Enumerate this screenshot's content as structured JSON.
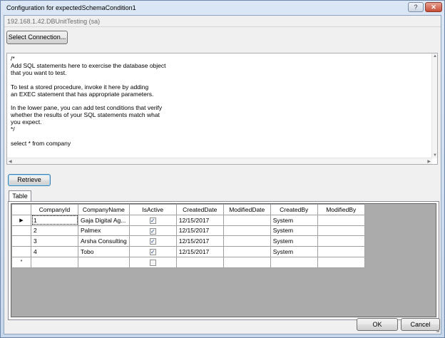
{
  "window": {
    "title": "Configuration for expectedSchemaCondition1",
    "help_label": "?",
    "close_label": "✕"
  },
  "connection": {
    "value": "192.168.1.42.DBUnitTesting (sa)",
    "select_button": "Select Connection..."
  },
  "sql": {
    "text": "/*\nAdd SQL statements here to exercise the database object\nthat you want to test.\n\nTo test a stored procedure, invoke it here by adding\nan EXEC statement that has appropriate parameters.\n\nIn the lower pane, you can add test conditions that verify\nwhether the results of your SQL statements match what\nyou expect.\n*/\n\nselect * from company"
  },
  "retrieve_button": "Retrieve",
  "tabs": [
    {
      "label": "Table"
    }
  ],
  "grid": {
    "columns": [
      "CompanyId",
      "CompanyName",
      "IsActive",
      "CreatedDate",
      "ModifiedDate",
      "CreatedBy",
      "ModifiedBy"
    ],
    "rows": [
      {
        "indicator": "▶",
        "CompanyId": "1",
        "CompanyName": "Gaja Digital Ag...",
        "IsActive": true,
        "CreatedDate": "12/15/2017",
        "ModifiedDate": "",
        "CreatedBy": "System",
        "ModifiedBy": ""
      },
      {
        "indicator": "",
        "CompanyId": "2",
        "CompanyName": "Palmex",
        "IsActive": true,
        "CreatedDate": "12/15/2017",
        "ModifiedDate": "",
        "CreatedBy": "System",
        "ModifiedBy": ""
      },
      {
        "indicator": "",
        "CompanyId": "3",
        "CompanyName": "Arsha Consulting",
        "IsActive": true,
        "CreatedDate": "12/15/2017",
        "ModifiedDate": "",
        "CreatedBy": "System",
        "ModifiedBy": ""
      },
      {
        "indicator": "",
        "CompanyId": "4",
        "CompanyName": "Tobo",
        "IsActive": true,
        "CreatedDate": "12/15/2017",
        "ModifiedDate": "",
        "CreatedBy": "System",
        "ModifiedBy": ""
      },
      {
        "indicator": "*",
        "CompanyId": "",
        "CompanyName": "",
        "IsActive": false,
        "CreatedDate": "",
        "ModifiedDate": "",
        "CreatedBy": "",
        "ModifiedBy": ""
      }
    ]
  },
  "footer": {
    "ok_label": "OK",
    "cancel_label": "Cancel"
  }
}
